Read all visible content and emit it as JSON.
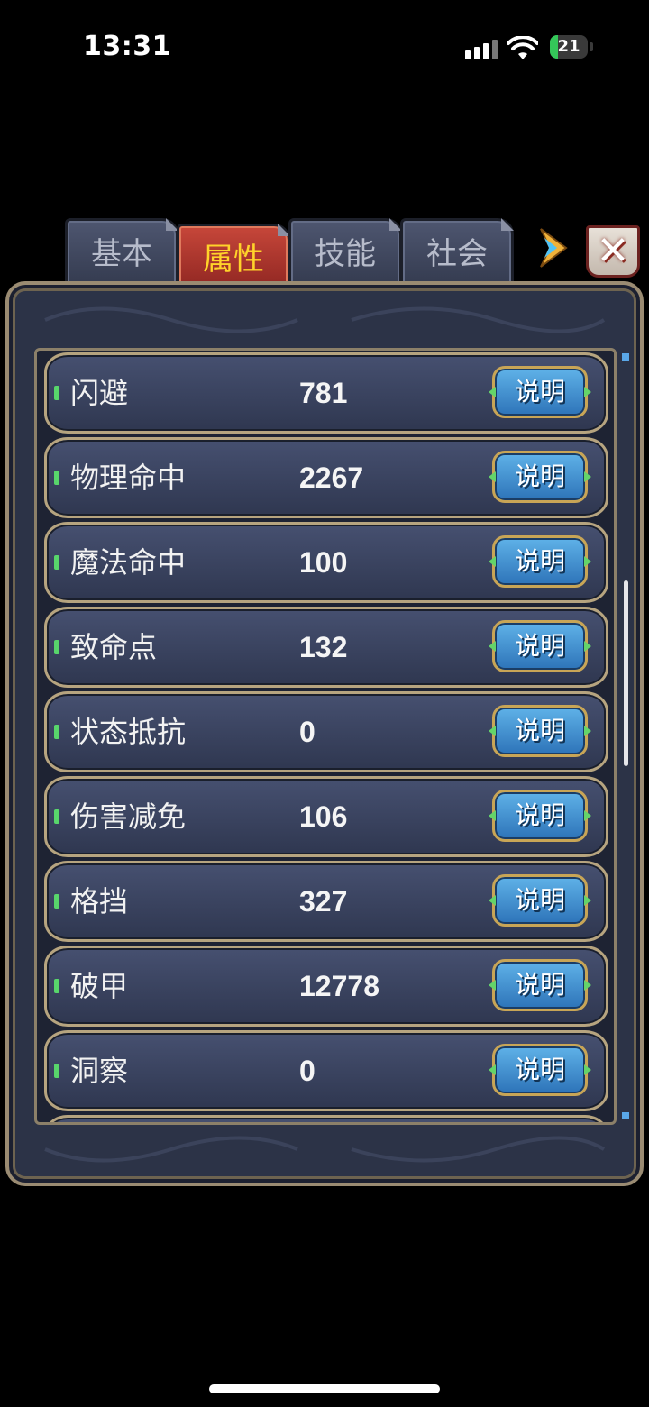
{
  "status_bar": {
    "time": "13:31",
    "battery": "21"
  },
  "tabs": [
    {
      "label": "基本",
      "active": false
    },
    {
      "label": "属性",
      "active": true
    },
    {
      "label": "技能",
      "active": false
    },
    {
      "label": "社会",
      "active": false
    }
  ],
  "close_label": "✕",
  "attributes": [
    {
      "label": "闪避",
      "value": "781",
      "button": "说明"
    },
    {
      "label": "物理命中",
      "value": "2267",
      "button": "说明"
    },
    {
      "label": "魔法命中",
      "value": "100",
      "button": "说明"
    },
    {
      "label": "致命点",
      "value": "132",
      "button": "说明"
    },
    {
      "label": "状态抵抗",
      "value": "0",
      "button": "说明"
    },
    {
      "label": "伤害减免",
      "value": "106",
      "button": "说明"
    },
    {
      "label": "格挡",
      "value": "327",
      "button": "说明"
    },
    {
      "label": "破甲",
      "value": "12778",
      "button": "说明"
    },
    {
      "label": "洞察",
      "value": "0",
      "button": "说明"
    }
  ],
  "colors": {
    "accent_gold": "#ffd32a",
    "button_blue": "#2d73b8",
    "panel_bg": "#2c3347"
  }
}
